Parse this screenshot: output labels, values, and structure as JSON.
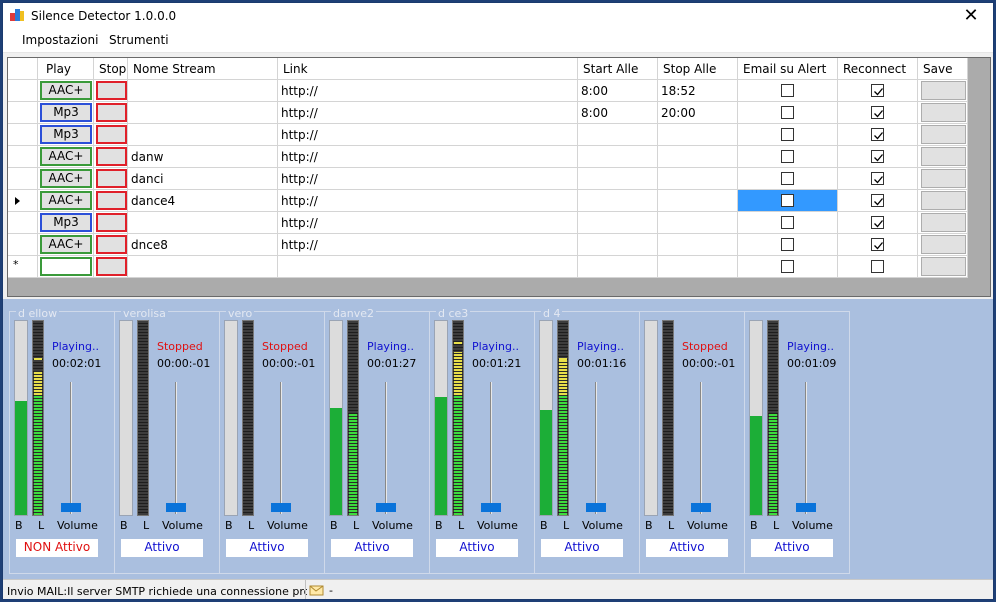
{
  "window": {
    "title": "Silence Detector 1.0.0.0",
    "close_glyph": "✕",
    "icon": "app-icon"
  },
  "menu": [
    {
      "label": "Impostazioni"
    },
    {
      "label": "Strumenti"
    }
  ],
  "grid": {
    "columns": [
      {
        "label": "Play"
      },
      {
        "label": "Stop"
      },
      {
        "label": "Nome Stream"
      },
      {
        "label": "Link"
      },
      {
        "label": "Start Alle"
      },
      {
        "label": "Stop Alle"
      },
      {
        "label": "Email su Alert"
      },
      {
        "label": "Reconnect"
      },
      {
        "label": "Save"
      }
    ],
    "rows": [
      {
        "play": "AAC+",
        "play_color": "#3a9a3a",
        "name": "",
        "link": "http://",
        "start": "8:00",
        "stop": "18:52",
        "email": false,
        "reconnect": true,
        "current": false,
        "new": false
      },
      {
        "play": "Mp3",
        "play_color": "#2b4fd8",
        "name": "",
        "link": "http://",
        "start": "8:00",
        "stop": "20:00",
        "email": false,
        "reconnect": true,
        "current": false,
        "new": false
      },
      {
        "play": "Mp3",
        "play_color": "#2b4fd8",
        "name": "",
        "link": "http://",
        "start": "",
        "stop": "",
        "email": false,
        "reconnect": true,
        "current": false,
        "new": false
      },
      {
        "play": "AAC+",
        "play_color": "#3a9a3a",
        "name": "danw",
        "link": "http://",
        "start": "",
        "stop": "",
        "email": false,
        "reconnect": true,
        "current": false,
        "new": false
      },
      {
        "play": "AAC+",
        "play_color": "#3a9a3a",
        "name": "danci",
        "link": "http://",
        "start": "",
        "stop": "",
        "email": false,
        "reconnect": true,
        "current": false,
        "new": false
      },
      {
        "play": "AAC+",
        "play_color": "#3a9a3a",
        "name": "dance4",
        "link": "http://",
        "start": "",
        "stop": "",
        "email": false,
        "reconnect": true,
        "current": true,
        "new": false
      },
      {
        "play": "Mp3",
        "play_color": "#2b4fd8",
        "name": "",
        "link": "http://",
        "start": "",
        "stop": "",
        "email": false,
        "reconnect": true,
        "current": false,
        "new": false
      },
      {
        "play": "AAC+",
        "play_color": "#3a9a3a",
        "name": "dnce8",
        "link": "http://",
        "start": "",
        "stop": "",
        "email": false,
        "reconnect": true,
        "current": false,
        "new": false
      },
      {
        "play": "",
        "play_color": "#3a9a3a",
        "name": "",
        "link": "",
        "start": "",
        "stop": "",
        "email": false,
        "reconnect": false,
        "current": false,
        "new": true
      }
    ]
  },
  "panels": [
    {
      "title": "d      ellow",
      "status": "Playing..",
      "status_color": "#1010d0",
      "time": "00:02:01",
      "buffer_level": 0.59,
      "vu_level": 0.74,
      "vu_peak": 0.8,
      "b_label": "B",
      "l_label": "L",
      "volume_label": "Volume",
      "active": "NON Attivo",
      "active_color": "#e01010"
    },
    {
      "title": "verolisa",
      "status": "Stopped",
      "status_color": "#e01010",
      "time": "00:00:-01",
      "buffer_level": 0,
      "vu_level": 0,
      "vu_peak": 0,
      "b_label": "B",
      "l_label": "L",
      "volume_label": "Volume",
      "active": "Attivo",
      "active_color": "#1010d0"
    },
    {
      "title": "vero",
      "status": "Stopped",
      "status_color": "#e01010",
      "time": "00:00:-01",
      "buffer_level": 0,
      "vu_level": 0,
      "vu_peak": 0,
      "b_label": "B",
      "l_label": "L",
      "volume_label": "Volume",
      "active": "Attivo",
      "active_color": "#1010d0"
    },
    {
      "title": "danve2",
      "status": "Playing..",
      "status_color": "#1010d0",
      "time": "00:01:27",
      "buffer_level": 0.55,
      "vu_level": 0.52,
      "vu_peak": 0.52,
      "b_label": "B",
      "l_label": "L",
      "volume_label": "Volume",
      "active": "Attivo",
      "active_color": "#1010d0"
    },
    {
      "title": "d      ce3",
      "status": "Playing..",
      "status_color": "#1010d0",
      "time": "00:01:21",
      "buffer_level": 0.61,
      "vu_level": 0.84,
      "vu_peak": 0.88,
      "b_label": "B",
      "l_label": "L",
      "volume_label": "Volume",
      "active": "Attivo",
      "active_color": "#1010d0"
    },
    {
      "title": "d      4",
      "status": "Playing..",
      "status_color": "#1010d0",
      "time": "00:01:16",
      "buffer_level": 0.54,
      "vu_level": 0.8,
      "vu_peak": 0.8,
      "b_label": "B",
      "l_label": "L",
      "volume_label": "Volume",
      "active": "Attivo",
      "active_color": "#1010d0"
    },
    {
      "title": "",
      "status": "Stopped",
      "status_color": "#e01010",
      "time": "00:00:-01",
      "buffer_level": 0,
      "vu_level": 0,
      "vu_peak": 0,
      "b_label": "B",
      "l_label": "L",
      "volume_label": "Volume",
      "active": "Attivo",
      "active_color": "#1010d0"
    },
    {
      "title": "",
      "status": "Playing..",
      "status_color": "#1010d0",
      "time": "00:01:09",
      "buffer_level": 0.51,
      "vu_level": 0.52,
      "vu_peak": 0.52,
      "b_label": "B",
      "l_label": "L",
      "volume_label": "Volume",
      "active": "Attivo",
      "active_color": "#1010d0"
    }
  ],
  "status_bar": {
    "message": "Invio MAIL:Il server SMTP richiede una connessione protetta op",
    "icon": "mail-status-icon",
    "dash": "-"
  },
  "colors": {
    "titlebar": "#ffffff",
    "panel_bg": "#aabfdf",
    "selection": "#3399ff",
    "buffer_green": "#1cae37"
  }
}
